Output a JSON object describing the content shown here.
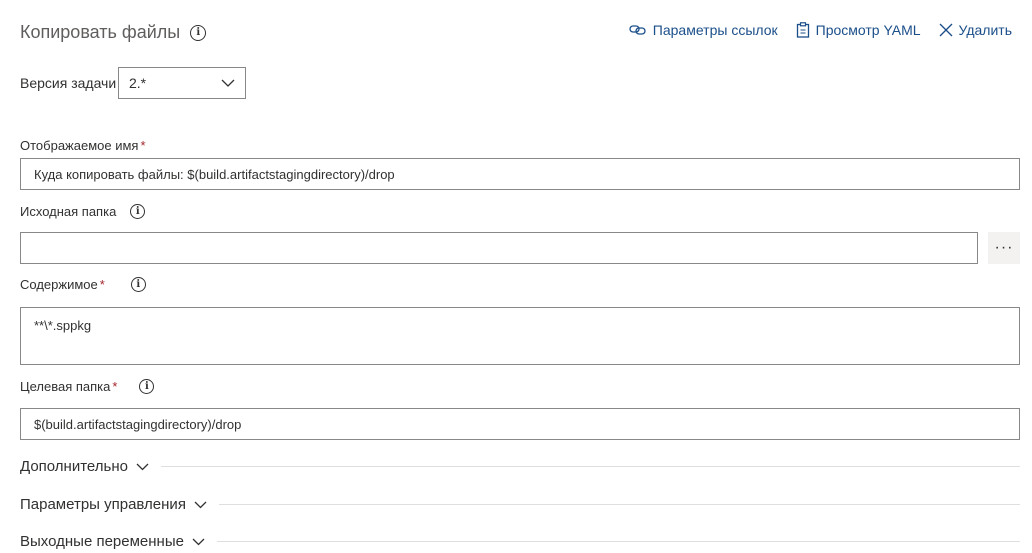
{
  "header": {
    "title": "Копировать файлы",
    "link_settings_label": "Параметры ссылок",
    "view_yaml_label": "Просмотр YAML",
    "delete_label": "Удалить"
  },
  "task_version": {
    "label": "Версия задачи",
    "value": "2.*"
  },
  "fields": {
    "display_name": {
      "label": "Отображаемое имя",
      "required": "*",
      "value": "Куда копировать файлы: $(build.artifactstagingdirectory)/drop"
    },
    "source_folder": {
      "label": "Исходная папка",
      "value": "",
      "more": "···"
    },
    "contents": {
      "label": "Содержимое",
      "required": "*",
      "value": "**\\*.sppkg"
    },
    "target_folder": {
      "label": "Целевая папка",
      "required": "*",
      "value": "$(build.artifactstagingdirectory)/drop"
    }
  },
  "sections": [
    {
      "label": "Дополнительно"
    },
    {
      "label": "Параметры управления"
    },
    {
      "label": "Выходные переменные"
    }
  ],
  "colors": {
    "link": "#1b4f8a",
    "required": "#a4262c",
    "border": "#8a8886"
  }
}
